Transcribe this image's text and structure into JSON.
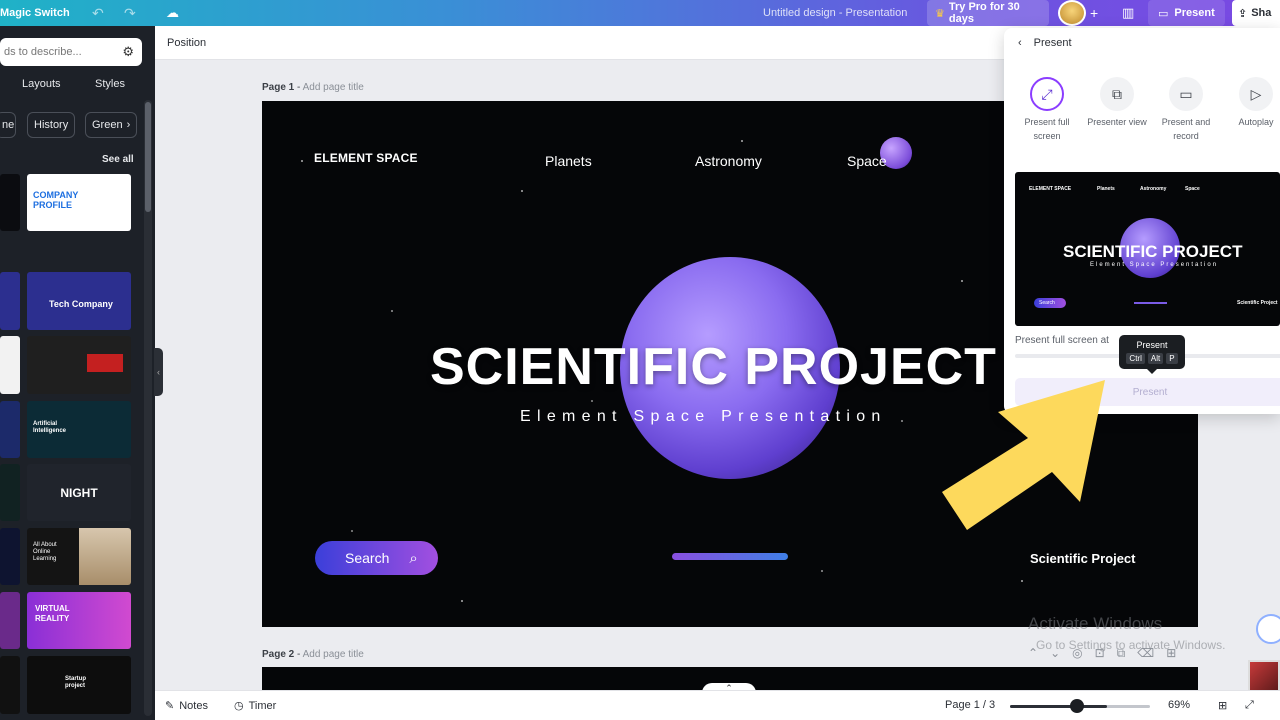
{
  "topbar": {
    "magic_switch": "Magic Switch",
    "design_title": "Untitled design - Presentation",
    "try_pro": "Try Pro for 30 days",
    "present": "Present",
    "share": "Sha"
  },
  "sidepanel": {
    "search_placeholder": "ds to describe...",
    "tabs": [
      "Layouts",
      "Styles"
    ],
    "chips": [
      "ne",
      "History",
      "Green"
    ],
    "see_all": "See all",
    "templates": [
      {
        "label": "COMPANY PROFILE",
        "bg": "#ffffff",
        "fg": "#1d6fe0"
      },
      {
        "label": "Tech Company",
        "bg": "#2c2f8f",
        "fg": "#ffffff"
      },
      {
        "label": "",
        "bg": "#1f1f1f",
        "fg": "#d33"
      },
      {
        "label": "Artificial Intelligence",
        "bg": "#0c2b36",
        "fg": "#ffffff"
      },
      {
        "label": "NIGHT",
        "bg": "#20242c",
        "fg": "#ffffff"
      },
      {
        "label": "All About Online Learning",
        "bg": "#141414",
        "fg": "#ffffff"
      },
      {
        "label": "VIRTUAL REALITY",
        "bg": "#8a2fd6",
        "fg": "#ffffff"
      },
      {
        "label": "Startup project",
        "bg": "#0d0d0d",
        "fg": "#ffffff"
      }
    ]
  },
  "canvas": {
    "position_label": "Position",
    "page1_label": "Page 1",
    "page1_title_placeholder": "Add page title",
    "page2_label": "Page 2",
    "page2_title_placeholder": "Add page title"
  },
  "slide": {
    "brand": "ELEMENT SPACE",
    "nav": [
      "Planets",
      "Astronomy",
      "Space"
    ],
    "title": "SCIENTIFIC PROJECT",
    "subtitle": "Element Space Presentation",
    "search_button": "Search",
    "footer_label": "Scientific Project"
  },
  "present_panel": {
    "header": "Present",
    "options": [
      {
        "label": "Present full screen",
        "icon": "expand-icon"
      },
      {
        "label": "Presenter view",
        "icon": "presenter-view-icon"
      },
      {
        "label": "Present and record",
        "icon": "record-icon"
      },
      {
        "label": "Autoplay",
        "icon": "play-icon"
      }
    ],
    "preview": {
      "brand": "ELEMENT SPACE",
      "nav": [
        "Planets",
        "Astronomy",
        "Space"
      ],
      "title": "SCIENTIFIC PROJECT",
      "subtitle": "Element Space Presentation",
      "search": "Search",
      "footer": "Scientific Project"
    },
    "note_visible": "Present full screen at",
    "note_tail": "e",
    "button": "Present"
  },
  "tooltip": {
    "title": "Present",
    "keys": [
      "Ctrl",
      "Alt",
      "P"
    ]
  },
  "bottombar": {
    "notes": "Notes",
    "timer": "Timer",
    "page_indicator": "Page 1 / 3",
    "zoom": "69%",
    "zoom_level": 0.69
  },
  "watermark": {
    "line1": "Activate Windows",
    "line2": "Go to Settings to activate Windows."
  },
  "colors": {
    "accent": "#8b3dff",
    "topbar_start": "#1fb2c7",
    "topbar_end": "#7a48e3",
    "arrow": "#fdd95c"
  }
}
